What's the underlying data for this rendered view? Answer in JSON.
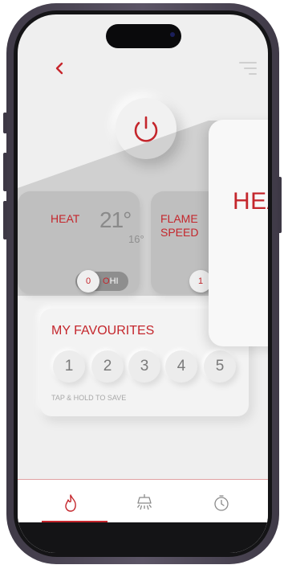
{
  "header": {
    "back_icon": "chevron-left-icon",
    "menu_icon": "menu-lines-icon"
  },
  "power": {
    "icon": "power-icon"
  },
  "heat_card": {
    "label": "HEAT",
    "temperature": "21°",
    "set_temperature": "16°",
    "toggle": {
      "knob_label": "0",
      "off_label": "O",
      "on_label": "HI"
    }
  },
  "flame_card": {
    "label_line1": "FLAME",
    "label_line2": "SPEED",
    "knob_label": "1"
  },
  "favourites": {
    "title": "MY FAVOURITES",
    "buttons": [
      "1",
      "2",
      "3",
      "4",
      "5"
    ],
    "hint": "TAP & HOLD TO SAVE"
  },
  "popup": {
    "title": "HEA"
  },
  "nav": {
    "items": [
      {
        "icon": "flame-icon",
        "active": true
      },
      {
        "icon": "light-icon",
        "active": false
      },
      {
        "icon": "timer-icon",
        "active": false
      }
    ]
  },
  "colors": {
    "accent": "#c4262c",
    "background": "#efefef",
    "card": "#dcdcdc"
  }
}
